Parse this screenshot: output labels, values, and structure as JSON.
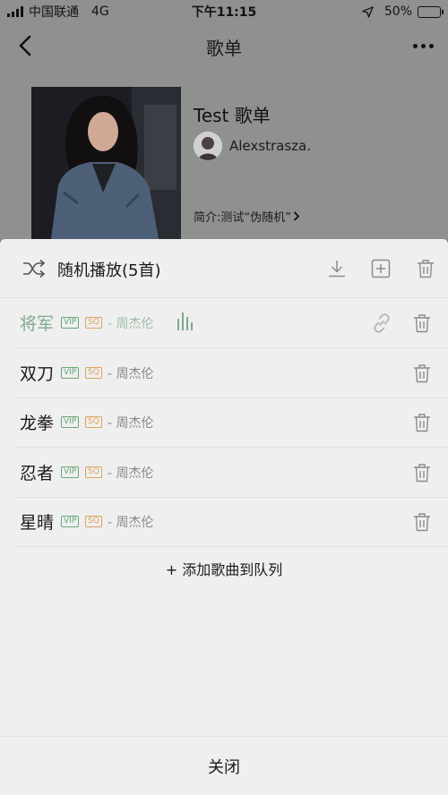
{
  "status_bar": {
    "carrier": "中国联通",
    "network": "4G",
    "time": "下午11:15",
    "battery_percent": "50%",
    "battery_level": 0.5
  },
  "nav": {
    "title": "歌单"
  },
  "playlist": {
    "title": "Test 歌单",
    "creator": "Alexstrasza.",
    "intro": "简介:测试“伪随机”"
  },
  "queue": {
    "title": "随机播放(5首)",
    "add_label": "+ 添加歌曲到队列",
    "close_label": "关闭",
    "songs": [
      {
        "title": "将军",
        "vip": "VIP",
        "sq": "SQ",
        "artist": "- 周杰伦",
        "playing": true
      },
      {
        "title": "双刀",
        "vip": "VIP",
        "sq": "SQ",
        "artist": "- 周杰伦",
        "playing": false
      },
      {
        "title": "龙拳",
        "vip": "VIP",
        "sq": "SQ",
        "artist": "- 周杰伦",
        "playing": false
      },
      {
        "title": "忍者",
        "vip": "VIP",
        "sq": "SQ",
        "artist": "- 周杰伦",
        "playing": false
      },
      {
        "title": "星晴",
        "vip": "VIP",
        "sq": "SQ",
        "artist": "- 周杰伦",
        "playing": false
      }
    ]
  },
  "colors": {
    "accent_green": "#7daa8c",
    "vip_green": "#67a777",
    "sq_gold": "#dba35e",
    "sheet_bg": "#efefef",
    "dim_bg": "#8f918f"
  },
  "icons": {
    "back": "chevron-left-icon",
    "more": "more-dots-icon",
    "shuffle": "shuffle-icon",
    "download": "download-icon",
    "add": "add-box-icon",
    "trash": "trash-icon",
    "link": "link-icon",
    "equalizer": "equalizer-icon",
    "intro_arrow": "chevron-right-icon"
  }
}
